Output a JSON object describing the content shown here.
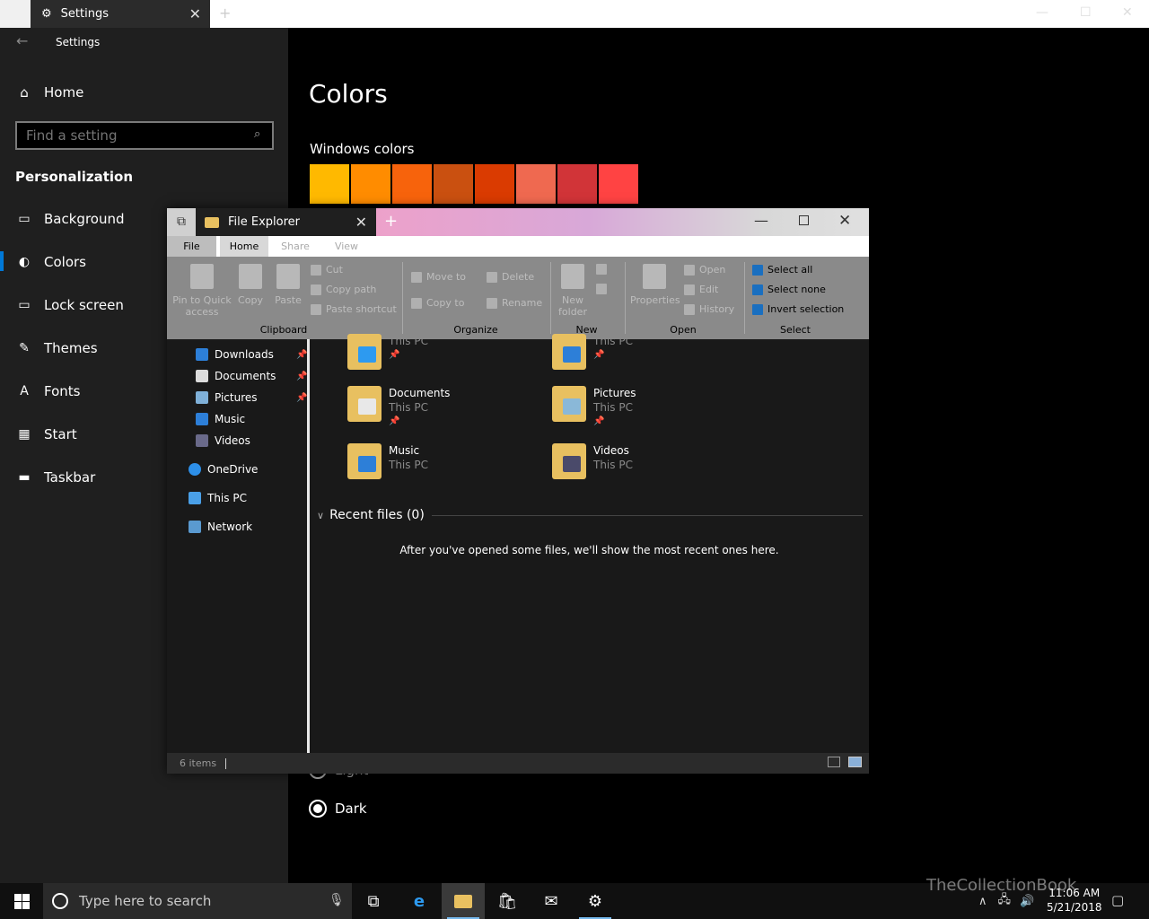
{
  "settings": {
    "tab_title": "Settings",
    "app_title": "Settings",
    "home_label": "Home",
    "search_placeholder": "Find a setting",
    "section": "Personalization",
    "nav": [
      {
        "label": "Background",
        "icon": "image-icon"
      },
      {
        "label": "Colors",
        "icon": "palette-icon",
        "selected": true
      },
      {
        "label": "Lock screen",
        "icon": "lock-screen-icon"
      },
      {
        "label": "Themes",
        "icon": "brush-icon"
      },
      {
        "label": "Fonts",
        "icon": "font-icon"
      },
      {
        "label": "Start",
        "icon": "start-icon"
      },
      {
        "label": "Taskbar",
        "icon": "taskbar-icon"
      }
    ],
    "page_title": "Colors",
    "windows_colors_label": "Windows colors",
    "swatches": [
      "#ffb900",
      "#ff8c00",
      "#f7630c",
      "#ca5010",
      "#da3b01",
      "#ef6950",
      "#d13438",
      "#ff4343"
    ],
    "app_mode_light": "Light",
    "app_mode_dark": "Dark",
    "accent": "#0078d7"
  },
  "explorer": {
    "tab_title": "File Explorer",
    "ribbon_tabs": {
      "file": "File",
      "home": "Home",
      "share": "Share",
      "view": "View"
    },
    "help": "?",
    "clipboard": {
      "group": "Clipboard",
      "pin_line1": "Pin to Quick",
      "pin_line2": "access",
      "copy": "Copy",
      "paste": "Paste",
      "cut": "Cut",
      "copy_path": "Copy path",
      "paste_shortcut": "Paste shortcut"
    },
    "organize": {
      "group": "Organize",
      "move_to": "Move to",
      "copy_to": "Copy to",
      "delete": "Delete",
      "rename": "Rename"
    },
    "new": {
      "group": "New",
      "new_folder_line1": "New",
      "new_folder_line2": "folder"
    },
    "open": {
      "group": "Open",
      "properties": "Properties",
      "open": "Open",
      "edit": "Edit",
      "history": "History"
    },
    "select": {
      "group": "Select",
      "select_all": "Select all",
      "select_none": "Select none",
      "invert": "Invert selection"
    },
    "nav_items": [
      {
        "label": "Downloads",
        "pinned": true
      },
      {
        "label": "Documents",
        "pinned": true
      },
      {
        "label": "Pictures",
        "pinned": true
      },
      {
        "label": "Music",
        "pinned": false
      },
      {
        "label": "Videos",
        "pinned": false
      },
      {
        "label": "OneDrive",
        "pinned": false
      },
      {
        "label": "This PC",
        "pinned": false
      },
      {
        "label": "Network",
        "pinned": false
      }
    ],
    "quick_access": [
      {
        "name": "",
        "location": "This PC",
        "pinned": true
      },
      {
        "name": "",
        "location": "This PC",
        "pinned": true
      },
      {
        "name": "Documents",
        "location": "This PC",
        "pinned": true
      },
      {
        "name": "Pictures",
        "location": "This PC",
        "pinned": true
      },
      {
        "name": "Music",
        "location": "This PC",
        "pinned": false
      },
      {
        "name": "Videos",
        "location": "This PC",
        "pinned": false
      }
    ],
    "recent_header": "Recent files (0)",
    "recent_empty": "After you've opened some files, we'll show the most recent ones here.",
    "status": "6 items"
  },
  "taskbar": {
    "search_placeholder": "Type here to search",
    "time": "11:06 AM",
    "date": "5/21/2018",
    "watermark": "TheCollectionBook"
  }
}
